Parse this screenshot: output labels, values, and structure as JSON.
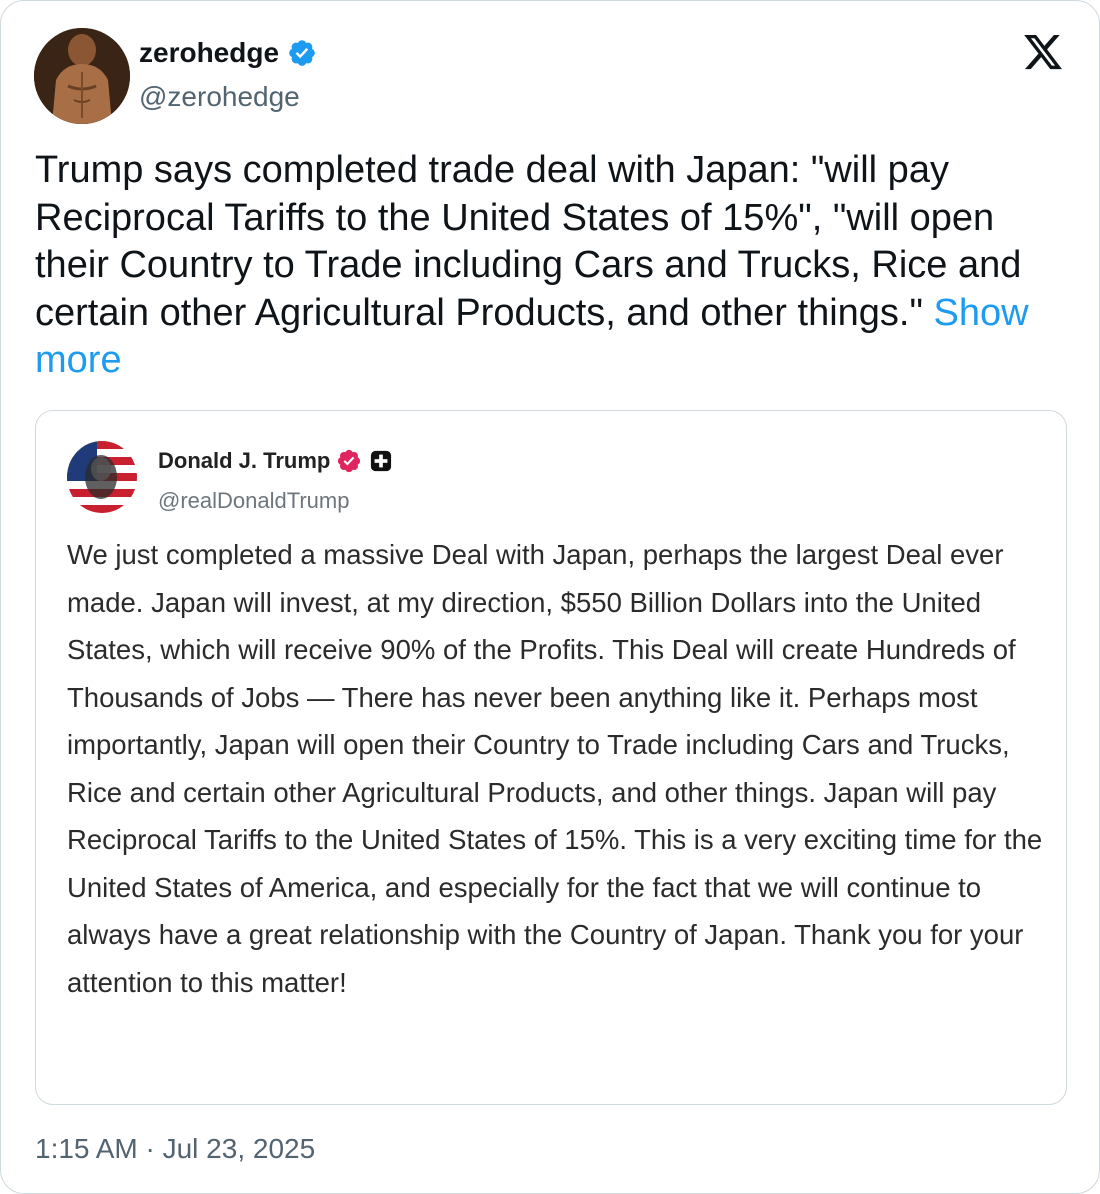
{
  "author": {
    "display_name": "zerohedge",
    "handle": "@zerohedge",
    "avatar_icon": "avatar-photo",
    "verified_badge": "verified-badge-icon",
    "verified_color": "#1d9bf0"
  },
  "platform": {
    "logo_icon": "x-logo-icon"
  },
  "tweet": {
    "text": "Trump says completed trade deal with Japan: \"will pay Reciprocal Tariffs to the United States of 15%\", \"will open their Country to Trade including Cars and Trucks, Rice and certain other Agricultural Products, and other things.\"",
    "show_more_label": "Show more",
    "link_color": "#1d9bf0"
  },
  "quoted_post": {
    "display_name": "Donald J. Trump",
    "handle": "@realDonaldTrump",
    "avatar_icon": "flag-portrait-avatar",
    "verified_badge": "verified-badge-icon",
    "verified_color": "#e0245e",
    "extra_badge": "plus-square-icon",
    "text": "We just completed a massive Deal with Japan, perhaps the largest Deal ever made. Japan will invest, at my direction, $550 Billion Dollars into the United States, which will receive 90% of the Profits. This Deal will create Hundreds of Thousands of Jobs — There has never been anything like it. Perhaps most importantly, Japan will open their Country to Trade including Cars and Trucks, Rice and certain other Agricultural Products, and other things. Japan will pay Reciprocal Tariffs to the United States of 15%. This is a very exciting time for the United States of America, and especially for the fact that we will continue to always have a great relationship with the Country of Japan. Thank you for your attention to this matter!"
  },
  "timestamp": "1:15 AM · Jul 23, 2025"
}
